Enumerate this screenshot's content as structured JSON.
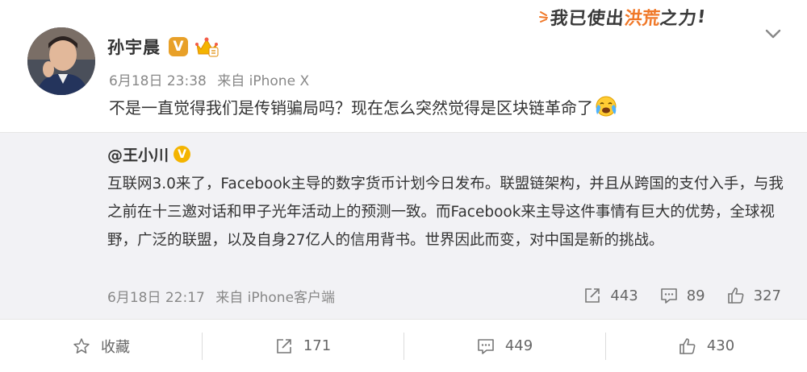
{
  "post": {
    "author": "孙宇晨",
    "verified_badge": "V",
    "date": "6月18日 23:38",
    "source": "来自 iPhone X",
    "text": "不是一直觉得我们是传销骗局吗？现在怎么突然觉得是区块链革命了",
    "emoji": "cry-emoji"
  },
  "stamp": {
    "part1": "我已使出",
    "part2": "洪荒",
    "part3": "之力",
    "bang": "!"
  },
  "repost": {
    "author": "@王小川",
    "verified_badge": "V",
    "text": "互联网3.0来了，Facebook主导的数字货币计划今日发布。联盟链架构，并且从跨国的支付入手，与我之前在十三邀对话和甲子光年活动上的预测一致。而Facebook来主导这件事情有巨大的优势，全球视野，广泛的联盟，以及自身27亿人的信用背书。世界因此而变，对中国是新的挑战。",
    "date": "6月18日 22:17",
    "source": "来自 iPhone客户端",
    "share_count": "443",
    "comment_count": "89",
    "like_count": "327"
  },
  "actions": {
    "favorite_label": "收藏",
    "share_count": "171",
    "comment_count": "449",
    "like_count": "430"
  },
  "colors": {
    "accent_orange": "#f07828",
    "badge_gold": "#e8a028",
    "repost_bg": "#f2f2f5"
  }
}
